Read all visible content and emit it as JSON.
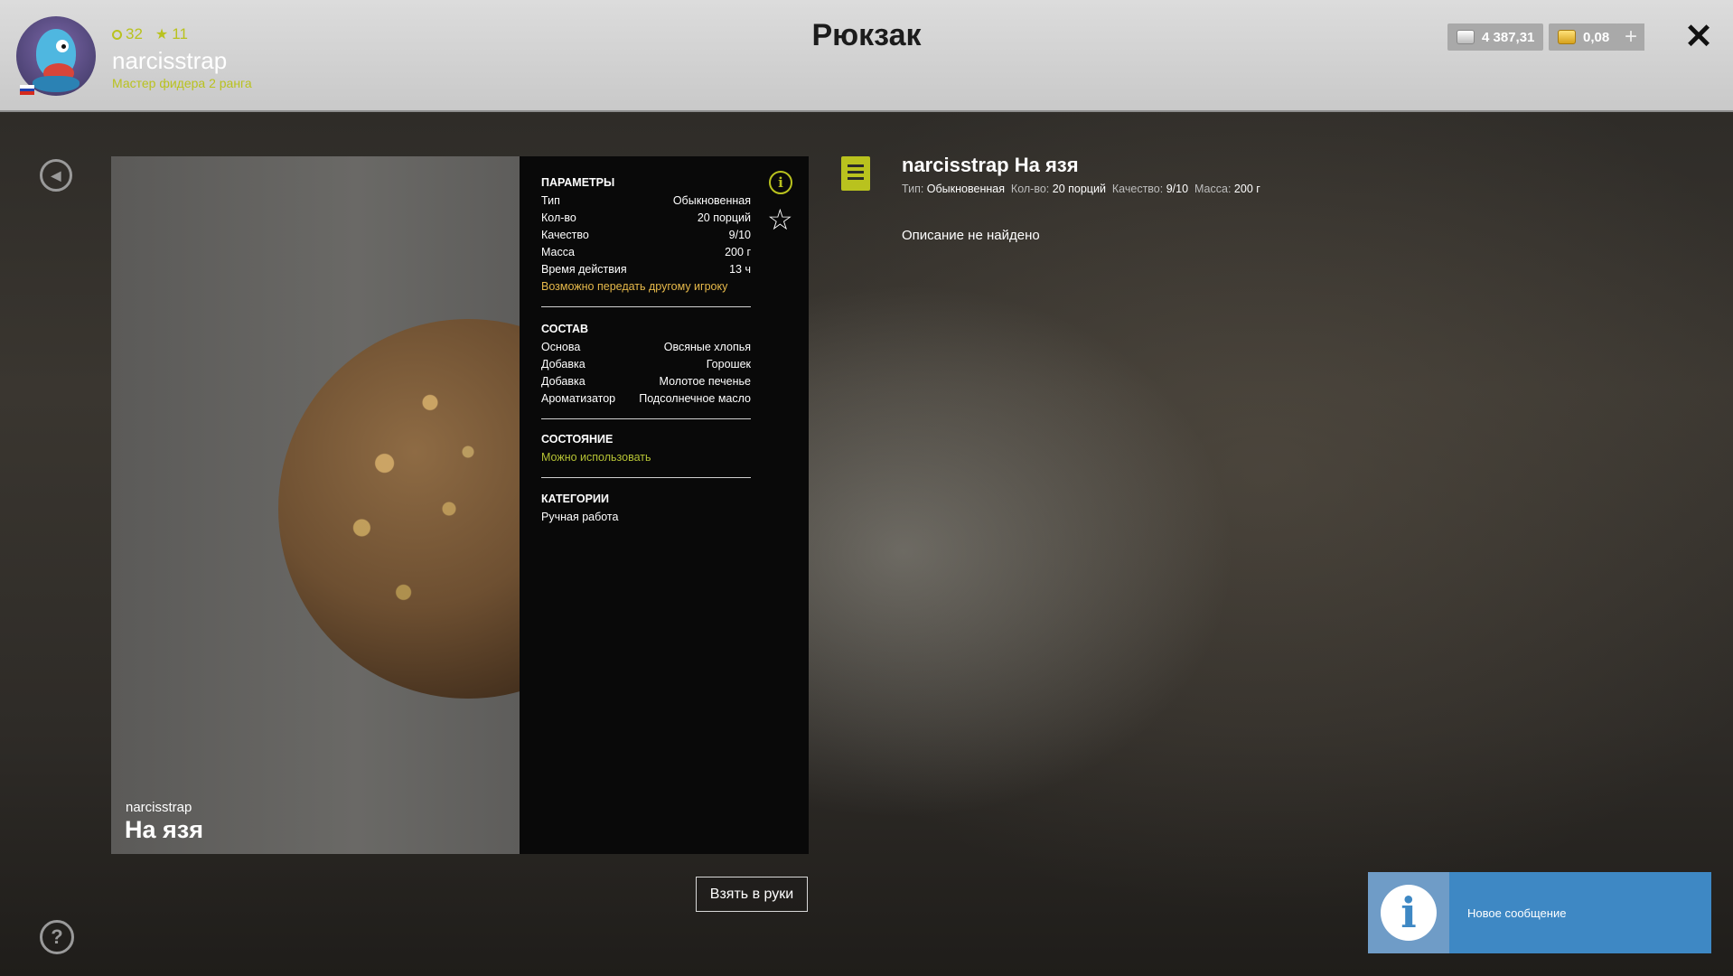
{
  "header": {
    "title": "Рюкзак",
    "level": "32",
    "stars": "11",
    "username": "narcisstrap",
    "rank": "Мастер фидера 2 ранга",
    "silver": "4 387,31",
    "gold": "0,08",
    "plus_label": "+",
    "close_label": "✕"
  },
  "preview": {
    "owner": "narcisstrap",
    "name": "На язя"
  },
  "params": {
    "title": "ПАРАМЕТРЫ",
    "rows": [
      {
        "label": "Тип",
        "value": "Обыкновенная"
      },
      {
        "label": "Кол-во",
        "value": "20 порций"
      },
      {
        "label": "Качество",
        "value": "9/10"
      },
      {
        "label": "Масса",
        "value": "200 г"
      },
      {
        "label": "Время действия",
        "value": "13 ч"
      }
    ],
    "transfer_note": "Возможно передать другому игроку"
  },
  "composition": {
    "title": "СОСТАВ",
    "rows": [
      {
        "label": "Основа",
        "value": "Овсяные хлопья"
      },
      {
        "label": "Добавка",
        "value": "Горошек"
      },
      {
        "label": "Добавка",
        "value": "Молотое печенье"
      },
      {
        "label": "Ароматизатор",
        "value": "Подсолнечное масло"
      }
    ]
  },
  "state": {
    "title": "СОСТОЯНИЕ",
    "value": "Можно использовать"
  },
  "categories": {
    "title": "КАТЕГОРИИ",
    "value": "Ручная работа"
  },
  "actions": {
    "take": "Взять в руки"
  },
  "detail": {
    "title": "narcisstrap На язя",
    "type_label": "Тип:",
    "type_value": "Обыкновенная",
    "qty_label": "Кол-во:",
    "qty_value": "20 порций",
    "quality_label": "Качество:",
    "quality_value": "9/10",
    "mass_label": "Масса:",
    "mass_value": "200 г",
    "description": "Описание не найдено"
  },
  "notification": {
    "text": "Новое сообщение"
  },
  "icons": {
    "info": "i",
    "favorite": "☆",
    "help": "?",
    "back": "◀"
  },
  "colors": {
    "accent": "#b9c21e",
    "note_yellow": "#e6b94a",
    "notification": "#3e88c4"
  }
}
